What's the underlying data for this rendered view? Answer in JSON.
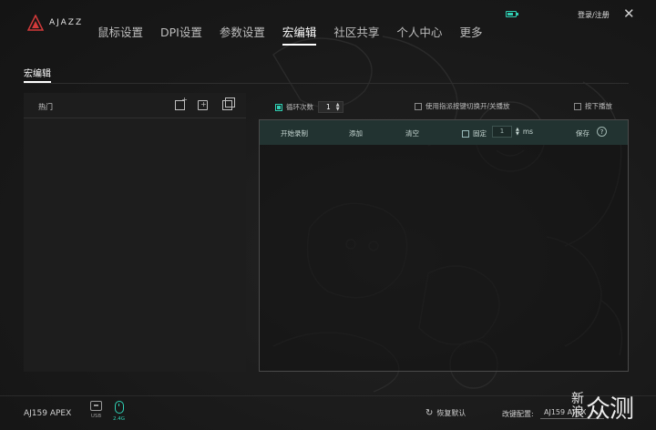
{
  "app": {
    "logo_text": "AJAZZ",
    "nav": [
      {
        "label": "鼠标设置",
        "active": false
      },
      {
        "label": "DPI设置",
        "active": false
      },
      {
        "label": "参数设置",
        "active": false
      },
      {
        "label": "宏编辑",
        "active": true
      },
      {
        "label": "社区共享",
        "active": false
      },
      {
        "label": "个人中心",
        "active": false
      },
      {
        "label": "更多",
        "active": false
      }
    ],
    "login_label": "登录/注册",
    "close_glyph": "✕",
    "battery_level": 0.6,
    "accent_color": "#2fd0b4"
  },
  "page": {
    "tab_label": "宏编辑"
  },
  "macro_list": {
    "title": "热门"
  },
  "options": {
    "loop_label": "循环次数",
    "loop_checked": true,
    "loop_count": "1",
    "toggle_label": "使用指派按键切换开/关播放",
    "toggle_checked": false,
    "press_label": "按下播放",
    "press_checked": false
  },
  "editor": {
    "record_label": "开始录制",
    "add_label": "添加",
    "clear_label": "清空",
    "fixed_label": "固定",
    "fixed_checked": false,
    "delay_value": "1",
    "delay_unit": "ms",
    "save_label": "保存",
    "help_glyph": "?"
  },
  "footer": {
    "device_name": "AJ159 APEX",
    "usb_label": "USB",
    "wireless_label": "2.4G",
    "restore_label": "恢复默认",
    "restore_glyph": "↻",
    "profile_label": "改键配置:",
    "profile_value": "AJ159 APEX"
  },
  "watermark": {
    "small_top": "新",
    "small_bottom": "浪",
    "big": "众测"
  }
}
